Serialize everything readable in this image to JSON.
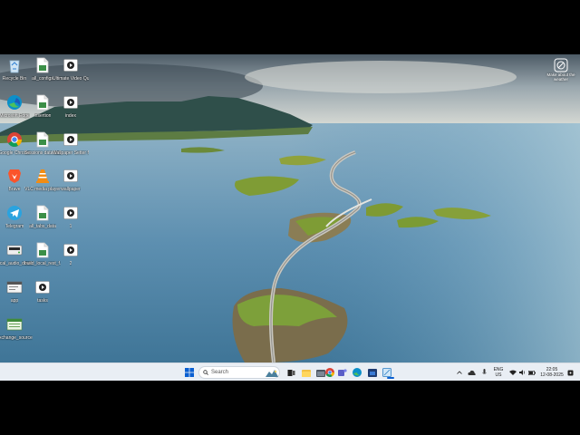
{
  "desktop": {
    "icons": [
      {
        "label": "Recycle Bin",
        "icon": "recycle-bin-icon"
      },
      {
        "label": "all_configs",
        "icon": "file-icon"
      },
      {
        "label": "Ultimate Video Qu...",
        "icon": "video-icon"
      },
      {
        "label": "Microsoft Edge",
        "icon": "edge-icon"
      },
      {
        "label": "insertion",
        "icon": "file-icon"
      },
      {
        "label": "index",
        "icon": "video-icon"
      },
      {
        "label": "Google Chrome",
        "icon": "chrome-icon"
      },
      {
        "label": "Sessions data sav...",
        "icon": "file-icon"
      },
      {
        "label": "Wallpaper Setter fo...",
        "icon": "video-icon"
      },
      {
        "label": "Brave",
        "icon": "brave-icon"
      },
      {
        "label": "VLC media player",
        "icon": "vlc-icon"
      },
      {
        "label": "wallpaper",
        "icon": "video-icon"
      },
      {
        "label": "Telegram",
        "icon": "telegram-icon"
      },
      {
        "label": "all_tabs_data",
        "icon": "file-icon"
      },
      {
        "label": "1",
        "icon": "video-icon"
      },
      {
        "label": "local_audio_device",
        "icon": "device-icon"
      },
      {
        "label": "build_local_rest_f...",
        "icon": "file-icon"
      },
      {
        "label": "2",
        "icon": "video-icon"
      },
      {
        "label": "app",
        "icon": "terminal-icon"
      },
      {
        "label": "tasks",
        "icon": "video-icon"
      },
      {
        "label": "exchange_source",
        "icon": "sheet-icon"
      }
    ]
  },
  "widget": {
    "label": "Make about the weather"
  },
  "taskbar": {
    "search_placeholder": "Search",
    "tray_lang_top": "ENG",
    "tray_lang_bottom": "US",
    "clock_time": "22:05",
    "clock_date": "12-08-2025",
    "pinned": [
      "scenery-icon",
      "task-view-icon",
      "file-explorer-icon",
      "folder-icon",
      "chrome-icon",
      "teams-icon",
      "edge-icon",
      "store-icon",
      "snipping-icon"
    ],
    "accent": "#0a5fd1"
  }
}
